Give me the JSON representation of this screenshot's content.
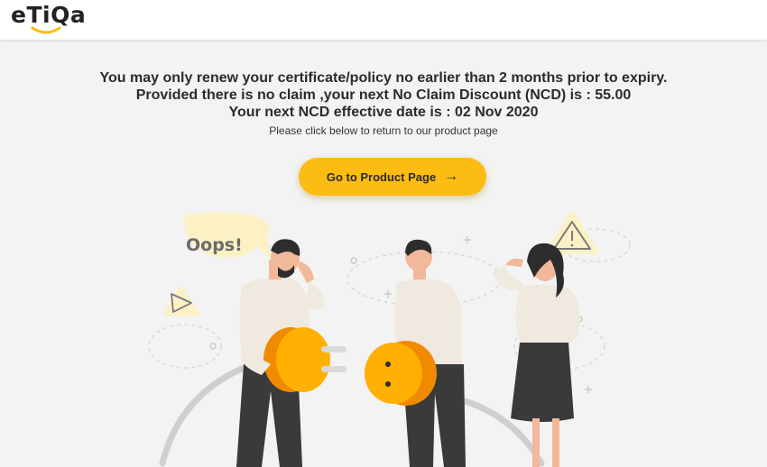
{
  "header": {
    "logo_text": "eTiQa"
  },
  "message": {
    "line1": "You may only renew your certificate/policy no earlier than 2 months prior to expiry.",
    "line2": "Provided there is no claim ,your next No Claim Discount (NCD) is : 55.00",
    "line3": "Your next NCD effective date is : 02 Nov 2020",
    "subtext": "Please click below to return to our product page"
  },
  "cta": {
    "label": "Go to Product Page",
    "icon": "arrow-right-icon"
  },
  "illustration": {
    "speech_bubble": "Oops!"
  },
  "colors": {
    "accent": "#fcbc11",
    "plug_orange": "#f08a00",
    "text": "#2b2b2b",
    "background": "#f3f3f3"
  }
}
